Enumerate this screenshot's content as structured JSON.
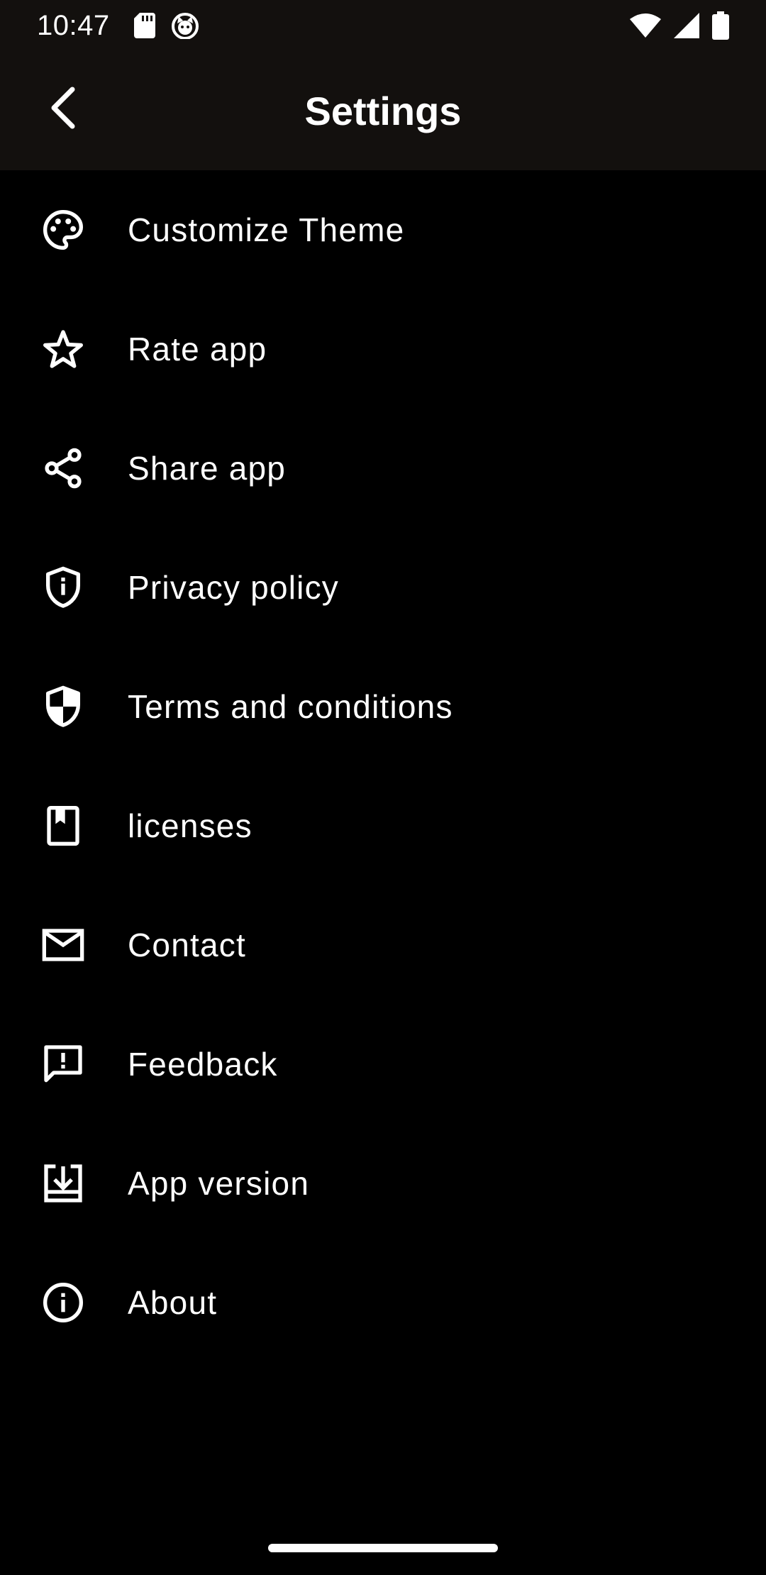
{
  "status_bar": {
    "time": "10:47",
    "icons": [
      "sd-card-icon",
      "cat-face-icon",
      "wifi-icon",
      "signal-icon",
      "battery-icon"
    ]
  },
  "app_bar": {
    "title": "Settings",
    "back_icon": "chevron-left-icon"
  },
  "settings": {
    "items": [
      {
        "label": "Customize Theme",
        "icon": "palette-icon"
      },
      {
        "label": "Rate app",
        "icon": "star-icon"
      },
      {
        "label": "Share app",
        "icon": "share-icon"
      },
      {
        "label": "Privacy policy",
        "icon": "shield-info-icon"
      },
      {
        "label": "Terms and conditions",
        "icon": "shield-half-icon"
      },
      {
        "label": "licenses",
        "icon": "book-bookmark-icon"
      },
      {
        "label": "Contact",
        "icon": "mail-icon"
      },
      {
        "label": "Feedback",
        "icon": "feedback-icon"
      },
      {
        "label": "App version",
        "icon": "download-box-icon"
      },
      {
        "label": "About",
        "icon": "info-icon"
      }
    ]
  },
  "colors": {
    "background": "#000000",
    "app_bar": "#13100e",
    "text": "#ffffff"
  }
}
